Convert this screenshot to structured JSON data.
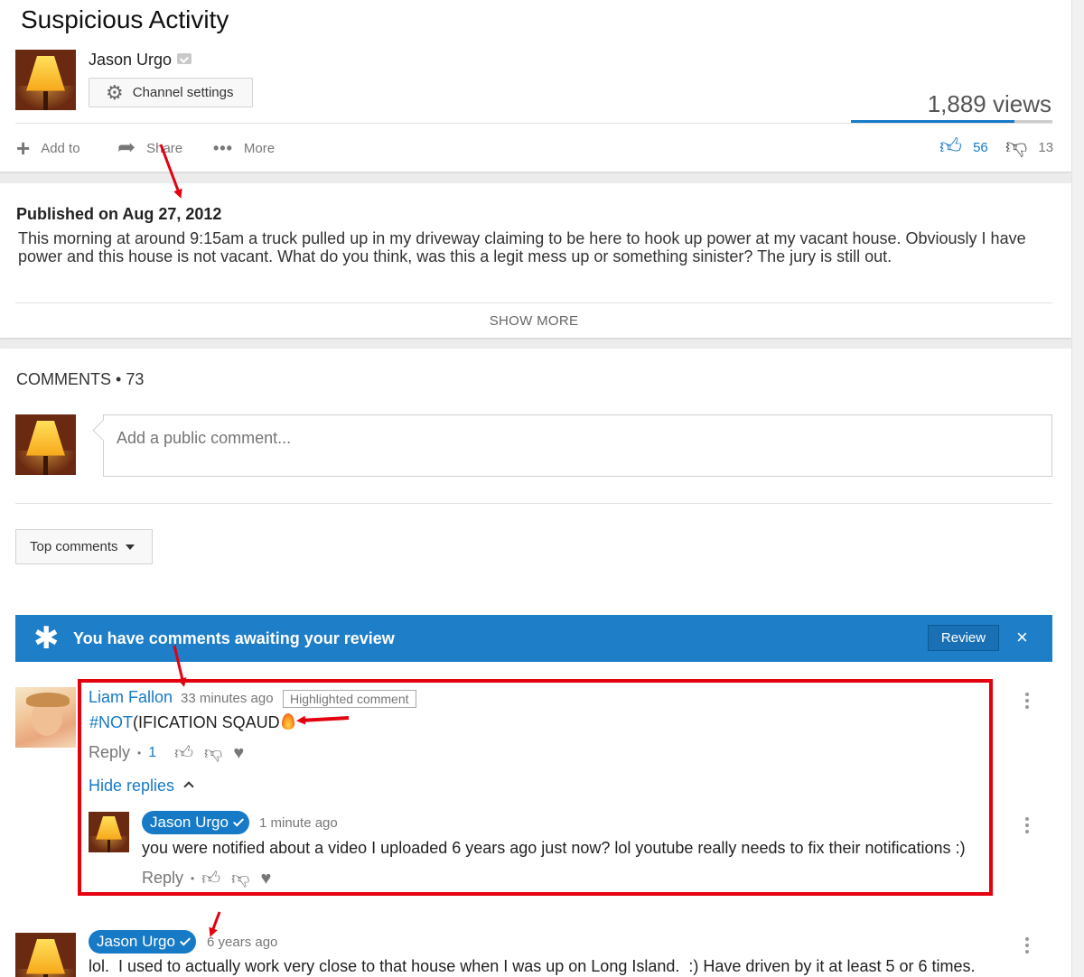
{
  "video": {
    "title": "Suspicious Activity",
    "channel_name": "Jason Urgo",
    "channel_settings_label": "Channel settings",
    "views": "1,889 views",
    "like_ratio": 0.81,
    "published": "Published on Aug 27, 2012",
    "description": "This morning at around 9:15am a truck pulled up in my driveway claiming to be here to hook up power at my vacant house. Obviously I have power and this house is not vacant. What do you think, was this a legit mess up or something sinister? The jury is still out.",
    "show_more": "SHOW MORE"
  },
  "actions": {
    "add_to": "Add to",
    "share": "Share",
    "more": "More",
    "likes": "56",
    "dislikes": "13"
  },
  "comments": {
    "header": "COMMENTS",
    "count": "73",
    "input_placeholder": "Add a public comment...",
    "sort_label": "Top comments"
  },
  "review_banner": {
    "message": "You have comments awaiting your review",
    "button": "Review",
    "close": "×"
  },
  "thread": {
    "author": "Liam Fallon",
    "time": "33 minutes ago",
    "badge": "Highlighted comment",
    "hashtag": "#NOT",
    "text": "(IFICATION SQAUD",
    "reply_label": "Reply",
    "like_count": "1",
    "hide_replies": "Hide replies",
    "reply": {
      "author": "Jason Urgo",
      "time": "1 minute ago",
      "text": "you were notified about a video I uploaded 6 years ago just now? lol youtube really needs to fix their notifications :)",
      "reply_label": "Reply"
    }
  },
  "comment2": {
    "author": "Jason Urgo",
    "time": "6 years ago",
    "text": "lol.  I used to actually work very close to that house when I was up on Long Island.  :) Have driven by it at least 5 or 6 times."
  },
  "colors": {
    "accent": "#167ac6",
    "banner": "#1e7ec8",
    "annotation": "#e3000f"
  },
  "icons": [
    "gear-icon",
    "plus-icon",
    "share-arrow-icon",
    "more-dots-icon",
    "thumbs-up-icon",
    "thumbs-down-icon",
    "star-icon",
    "close-icon",
    "heart-icon",
    "chevron-up-icon",
    "kebab-menu-icon",
    "caret-down-icon"
  ]
}
